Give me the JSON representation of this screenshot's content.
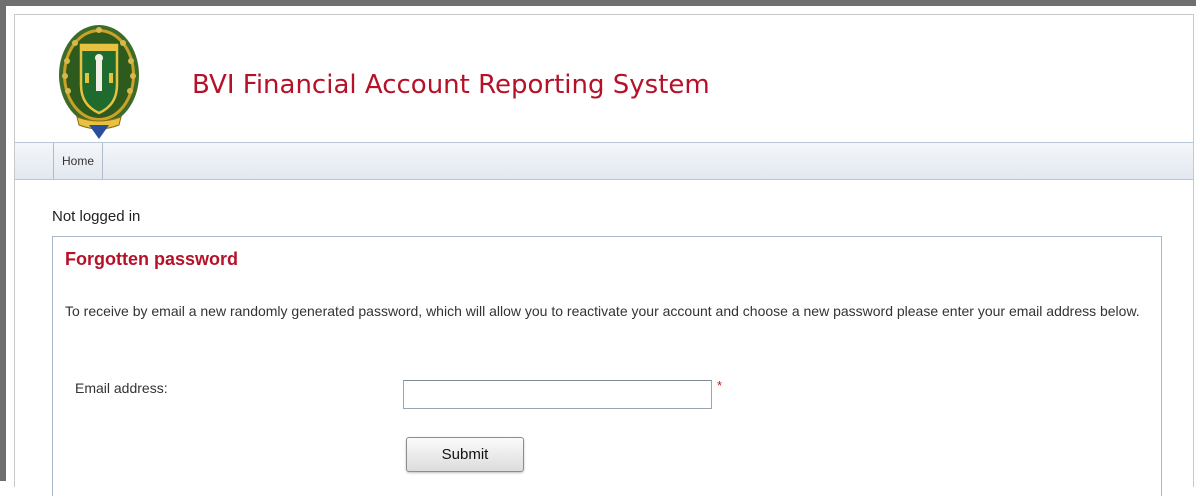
{
  "header": {
    "site_title": "BVI Financial Account Reporting System",
    "logo_icon": "bvi-coat-of-arms-icon"
  },
  "nav": {
    "items": [
      {
        "label": "Home"
      }
    ]
  },
  "status": {
    "login_text": "Not logged in"
  },
  "form": {
    "title": "Forgotten password",
    "description": "To receive by email a new randomly generated password, which will allow you to reactivate your account and choose a new password please enter your email address below.",
    "email_label": "Email address:",
    "email_value": "",
    "email_placeholder": "",
    "required_marker": "*",
    "submit_label": "Submit"
  },
  "colors": {
    "accent_title": "#b5122a",
    "nav_background": "#e8eef4",
    "panel_border": "#a9b8c9",
    "required": "#cc1111"
  }
}
